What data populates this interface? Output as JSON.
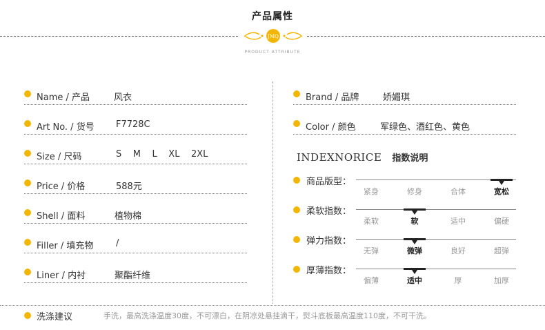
{
  "header": {
    "title": "产品属性",
    "emblem": "JMQ",
    "subtitle": "PRODUCT ATTRIBUTE"
  },
  "left_attributes": [
    {
      "label": "Name / 产品",
      "value": "风衣"
    },
    {
      "label": "Art No. / 货号",
      "value": "F7728C"
    },
    {
      "label": "Size / 尺码",
      "value": "S    M    L    XL    2XL"
    },
    {
      "label": "Price /  价格",
      "value": "588元"
    },
    {
      "label": "Shell /  面料",
      "value": "植物棉"
    },
    {
      "label": "Filler /  填充物",
      "value": "/"
    },
    {
      "label": "Liner /  内衬",
      "value": "聚酯纤维"
    }
  ],
  "right_attributes": [
    {
      "label": "Brand / 品牌",
      "value": "娇媚琪"
    },
    {
      "label": "Color / 颜色",
      "value": "军绿色、酒红色、黄色"
    }
  ],
  "index": {
    "title_en": "INDEXNORICE",
    "title_zh": "指数说明",
    "scales": [
      {
        "label": "商品版型：",
        "options": [
          "紧身",
          "修身",
          "合体",
          "宽松"
        ],
        "selected": 3
      },
      {
        "label": "柔软指数：",
        "options": [
          "柔软",
          "软",
          "适中",
          "偏硬"
        ],
        "selected": 1
      },
      {
        "label": "弹力指数：",
        "options": [
          "无弹",
          "微弹",
          "良好",
          "超弹"
        ],
        "selected": 1
      },
      {
        "label": "厚薄指数：",
        "options": [
          "偏薄",
          "适中",
          "厚",
          "加厚"
        ],
        "selected": 1
      }
    ]
  },
  "care": {
    "label": "洗涤建议",
    "text": "手洗，最高洗涤温度30度，不可漂白，在阴凉处悬挂滴干，熨斗底板最高温度110度，不可干洗。"
  },
  "colors": {
    "accent": "#f2b705",
    "text": "#333333",
    "muted": "#999999"
  }
}
